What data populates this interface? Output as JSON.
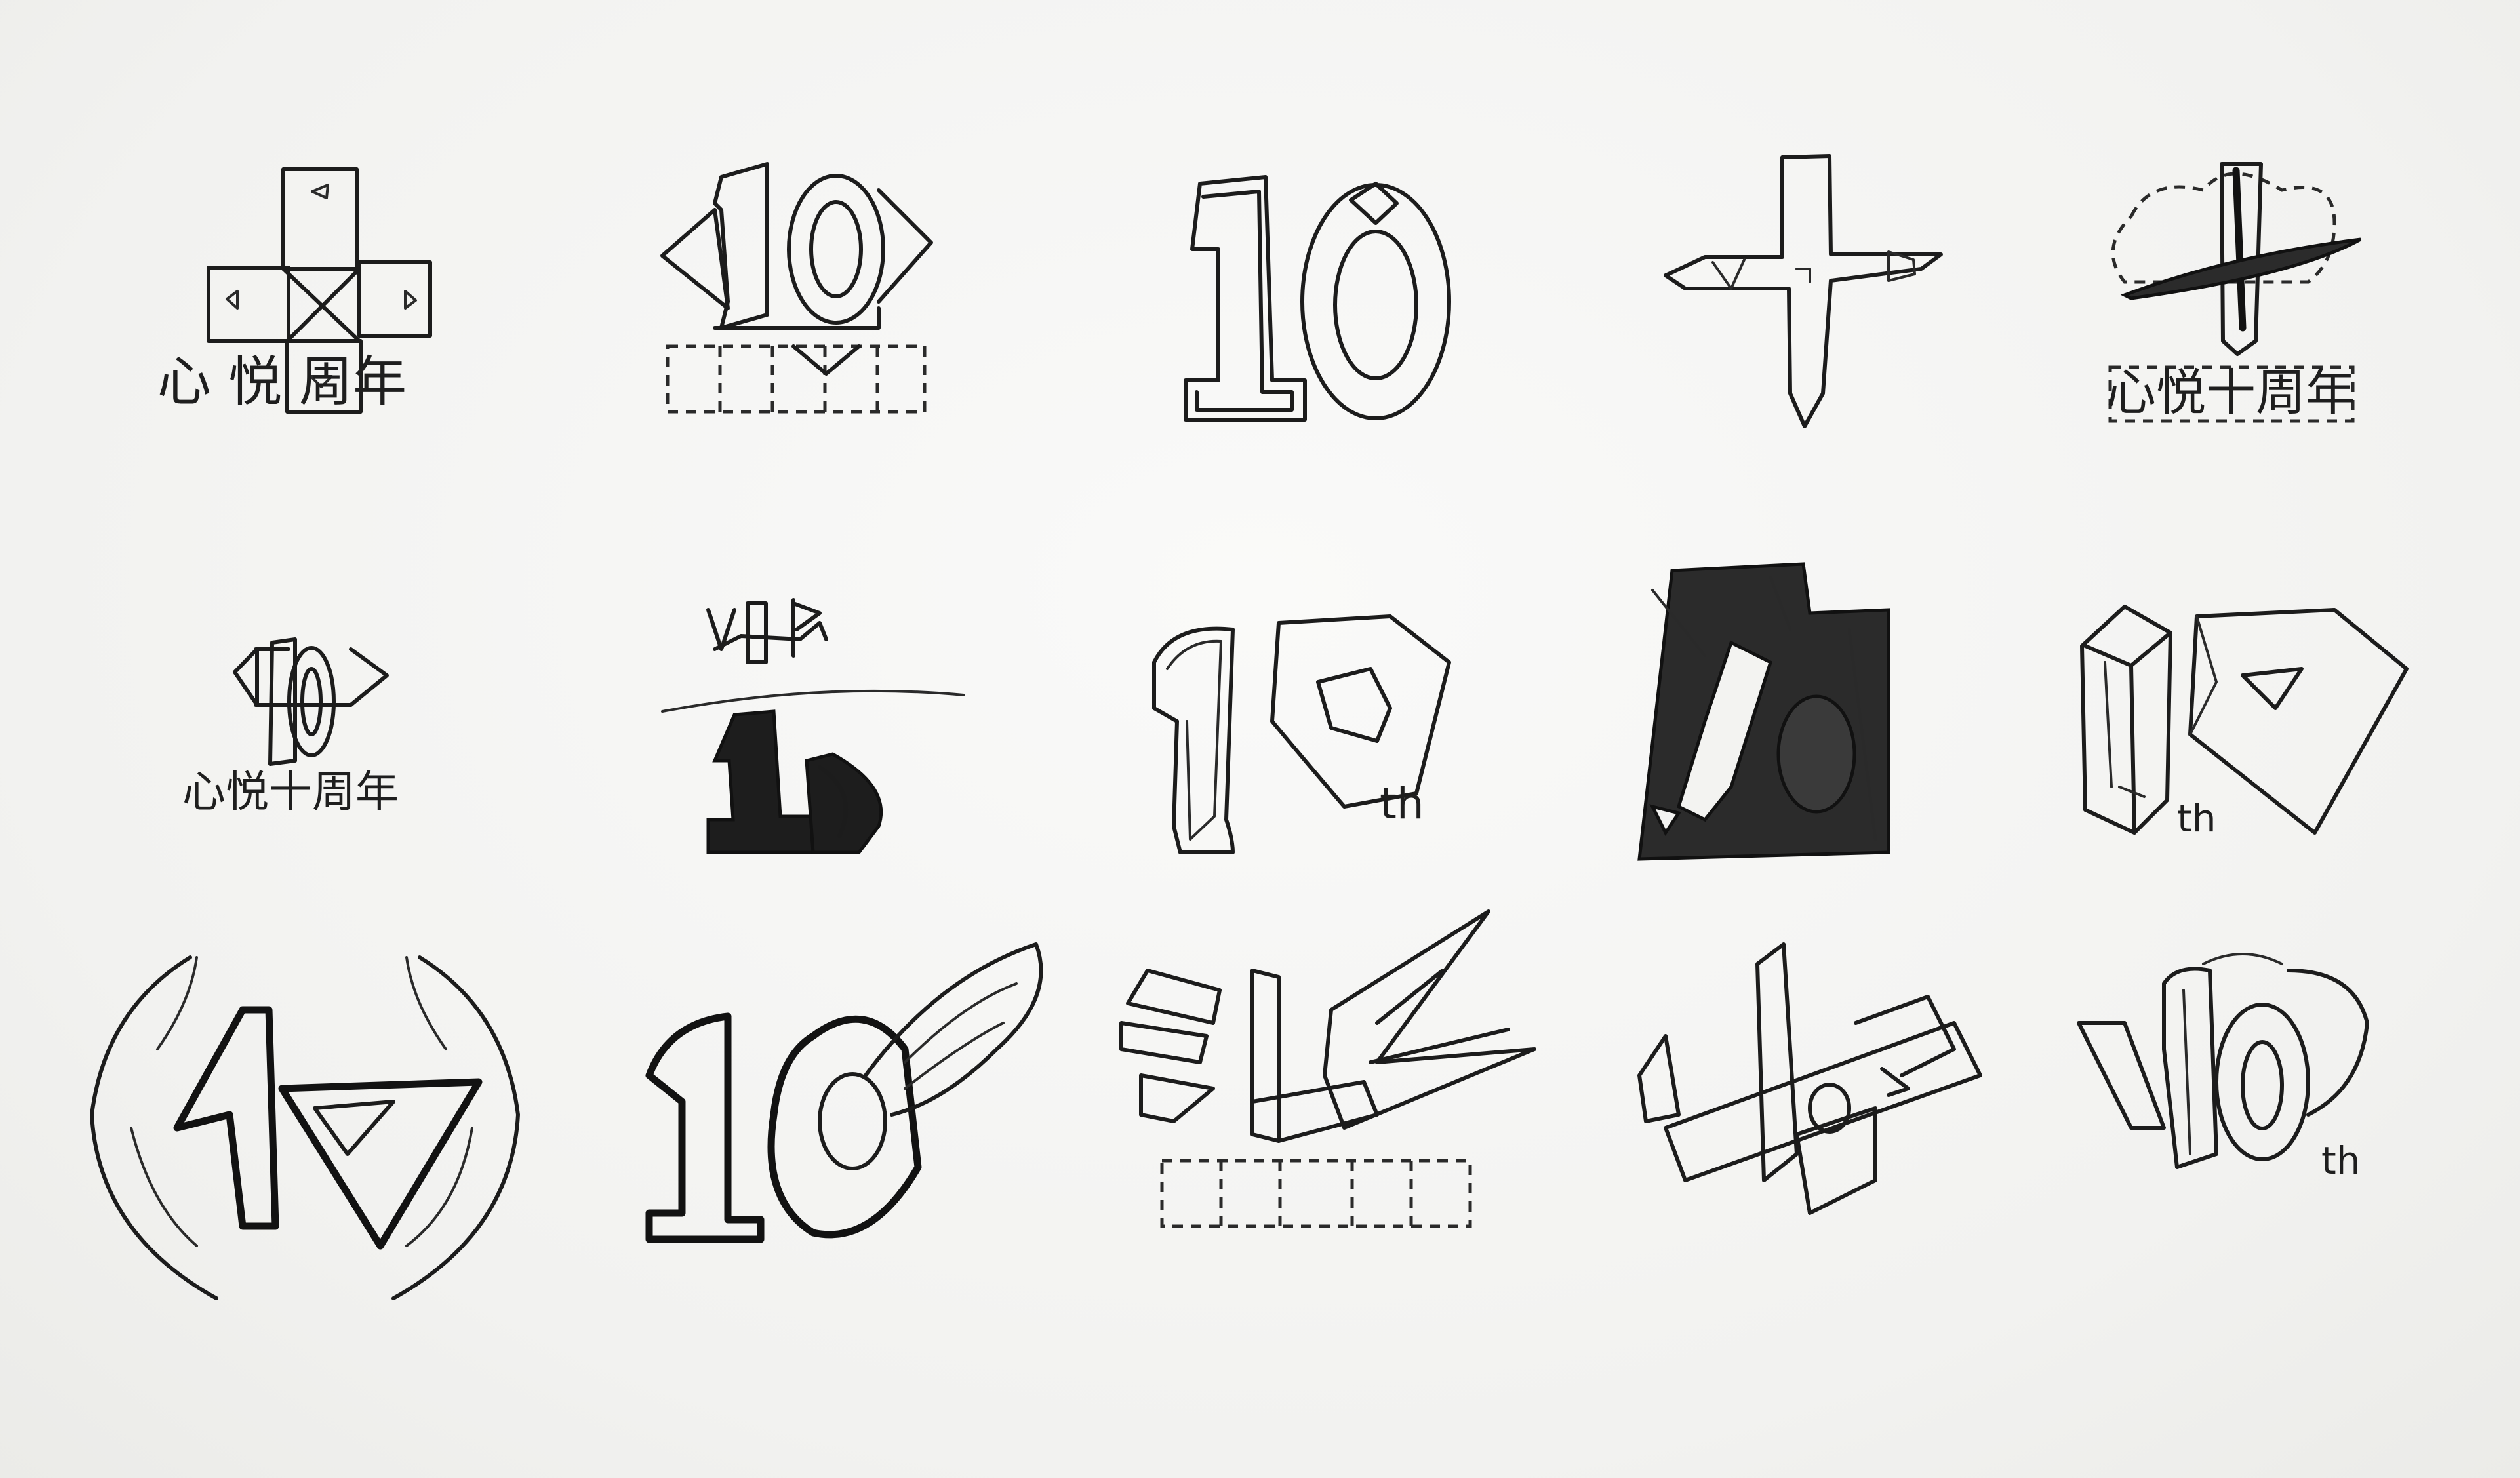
{
  "sheet": {
    "background": "#f3f3f1",
    "ink_color": "#1c1c1c"
  },
  "captions": {
    "sketch_1": "心 悦   周年",
    "sketch_5": "心悦十周年",
    "sketch_6": "心悦十周年",
    "th_label": "th"
  },
  "sketches": [
    {
      "row": 1,
      "col": 1,
      "motif": "dpad-cross"
    },
    {
      "row": 1,
      "col": 2,
      "motif": "diamond-10-with-boxes"
    },
    {
      "row": 1,
      "col": 3,
      "motif": "outline-10"
    },
    {
      "row": 1,
      "col": 4,
      "motif": "vip-cross"
    },
    {
      "row": 1,
      "col": 5,
      "motif": "sword-emblem"
    },
    {
      "row": 2,
      "col": 1,
      "motif": "diamond-10-small"
    },
    {
      "row": 2,
      "col": 2,
      "motif": "vip-over-filled-10"
    },
    {
      "row": 2,
      "col": 3,
      "motif": "10th-outline"
    },
    {
      "row": 2,
      "col": 4,
      "motif": "shaded-square-10"
    },
    {
      "row": 2,
      "col": 5,
      "motif": "3d-10th-diamond"
    },
    {
      "row": 3,
      "col": 1,
      "motif": "winged-10"
    },
    {
      "row": 3,
      "col": 2,
      "motif": "flame-10"
    },
    {
      "row": 3,
      "col": 3,
      "motif": "leaf-burst-with-boxes"
    },
    {
      "row": 3,
      "col": 4,
      "motif": "isometric-vip"
    },
    {
      "row": 3,
      "col": 5,
      "motif": "layered-10th"
    }
  ]
}
